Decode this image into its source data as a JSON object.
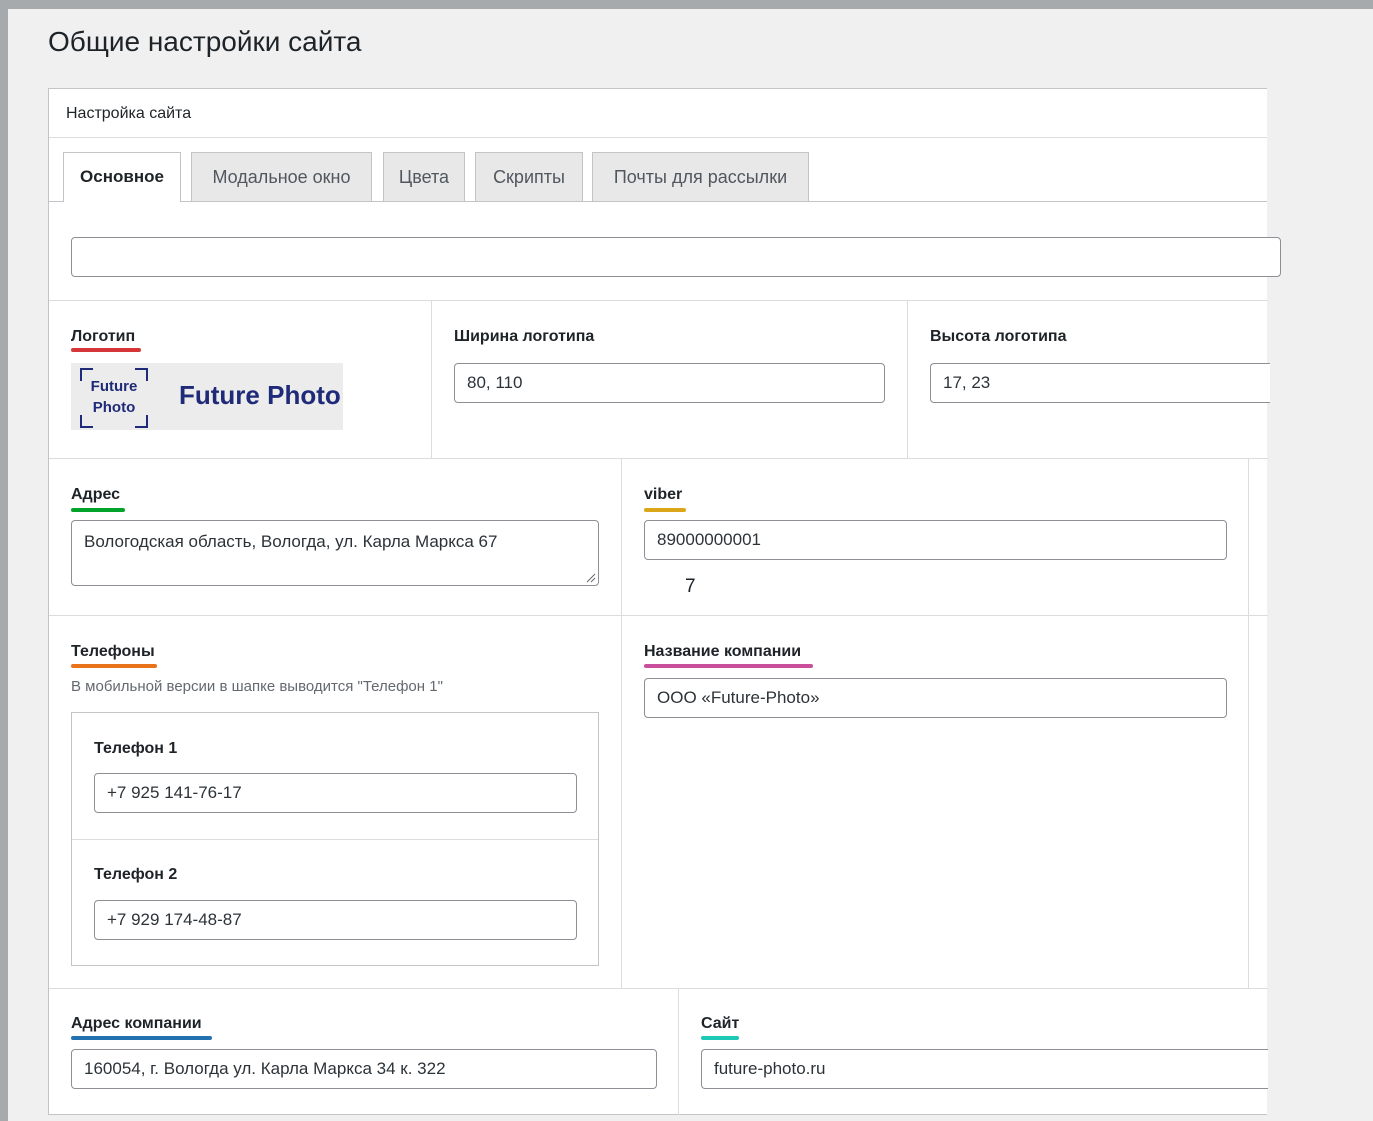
{
  "page": {
    "title": "Общие настройки сайта"
  },
  "box": {
    "title": "Настройка сайта"
  },
  "tabs": [
    {
      "label": "Основное",
      "active": true
    },
    {
      "label": "Модальное окно",
      "active": false
    },
    {
      "label": "Цвета",
      "active": false
    },
    {
      "label": "Скрипты",
      "active": false
    },
    {
      "label": "Почты для рассылки",
      "active": false
    }
  ],
  "fields": {
    "top_input": {
      "value": ""
    },
    "logo": {
      "label": "Логотип",
      "underline_color": "#d63638",
      "mark_line1": "Future",
      "mark_line2": "Photo",
      "wordmark": "Future Photo",
      "brand_color": "#1f2a78"
    },
    "logo_width": {
      "label": "Ширина логотипа",
      "value": "80, 110"
    },
    "logo_height": {
      "label": "Высота логотипа",
      "value": "17, 23"
    },
    "address": {
      "label": "Адрес",
      "underline_color": "#00a32a",
      "value": "Вологодская область, Вологда, ул. Карла Маркса 67"
    },
    "viber": {
      "label": "viber",
      "underline_color": "#dba617",
      "value": "89000000001",
      "extra_text": "7"
    },
    "phones": {
      "label": "Телефоны",
      "underline_color": "#e8731a",
      "hint": "В мобильной версии в шапке выводится \"Телефон 1\"",
      "items": [
        {
          "label": "Телефон 1",
          "value": "+7 925 141-76-17"
        },
        {
          "label": "Телефон 2",
          "value": "+7 929 174-48-87"
        }
      ]
    },
    "company_name": {
      "label": "Название компании",
      "underline_color": "#c94f9c",
      "value": "ООО «Future-Photo»"
    },
    "company_address": {
      "label": "Адрес компании",
      "underline_color": "#2271b1",
      "value": "160054, г. Вологда ул. Карла Маркса 34 к. 322"
    },
    "site": {
      "label": "Сайт",
      "underline_color": "#1ec9b8",
      "value": "future-photo.ru"
    }
  }
}
